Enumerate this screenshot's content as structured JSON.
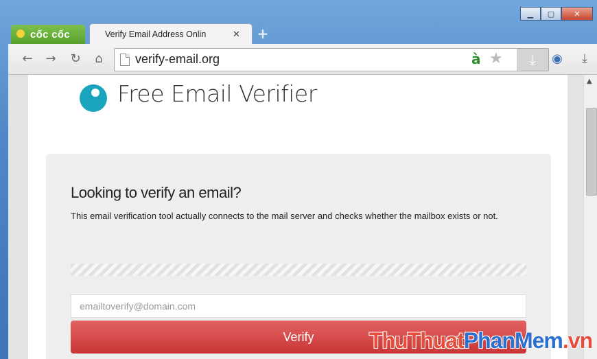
{
  "browser": {
    "brand": "cốc cốc",
    "tab": {
      "title": "Verify Email Address Onlin",
      "close": "✕"
    },
    "new_tab": "+",
    "window_buttons": {
      "minimize": "▁",
      "maximize": "▢",
      "close": "✕"
    },
    "toolbar": {
      "back": "←",
      "forward": "→",
      "reload": "↻",
      "home": "⌂",
      "url": "verify-email.org",
      "address_icon": "à",
      "star": "★",
      "download_page": "⤓",
      "camera": "◉",
      "downloads": "⤓"
    }
  },
  "page": {
    "brand_title": "Free Email Verifier",
    "heading": "Looking to verify an email?",
    "description": "This email verification tool actually connects to the mail server and checks whether the mailbox exists or not.",
    "email_input": {
      "placeholder": "emailtoverify@domain.com",
      "value": ""
    },
    "verify_button": "Verify"
  },
  "watermark": {
    "part1": "ThuThuat",
    "part2": "PhanMem",
    "part3": ".vn"
  },
  "colors": {
    "accent": "#1aa3bd",
    "button": "#d44848",
    "brand_green": "#58a22c"
  }
}
